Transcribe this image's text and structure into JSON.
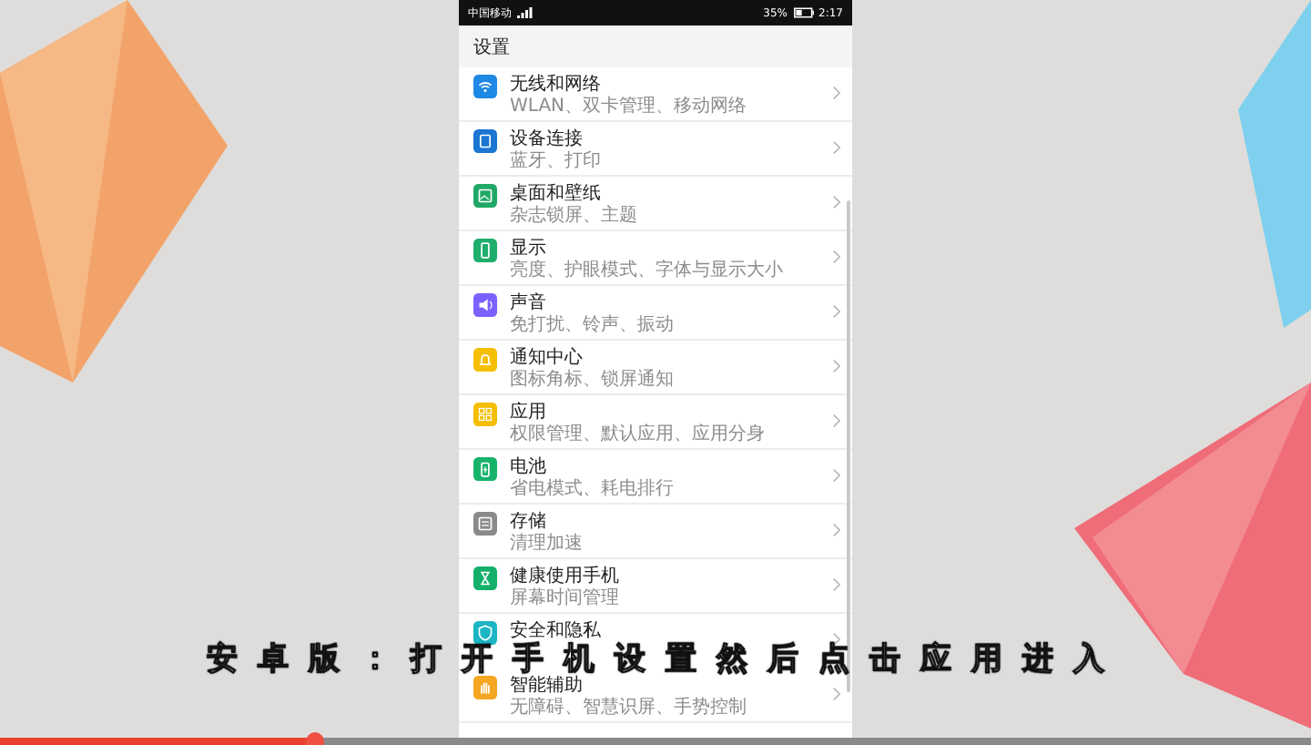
{
  "status_bar": {
    "carrier": "中国移动",
    "battery": "35%",
    "time": "2:17"
  },
  "header": {
    "title": "设置"
  },
  "items": [
    {
      "title": "无线和网络",
      "subtitle": "WLAN、双卡管理、移动网络"
    },
    {
      "title": "设备连接",
      "subtitle": "蓝牙、打印"
    },
    {
      "title": "桌面和壁纸",
      "subtitle": "杂志锁屏、主题"
    },
    {
      "title": "显示",
      "subtitle": "亮度、护眼模式、字体与显示大小"
    },
    {
      "title": "声音",
      "subtitle": "免打扰、铃声、振动"
    },
    {
      "title": "通知中心",
      "subtitle": "图标角标、锁屏通知"
    },
    {
      "title": "应用",
      "subtitle": "权限管理、默认应用、应用分身"
    },
    {
      "title": "电池",
      "subtitle": "省电模式、耗电排行"
    },
    {
      "title": "存储",
      "subtitle": "清理加速"
    },
    {
      "title": "健康使用手机",
      "subtitle": "屏幕时间管理"
    },
    {
      "title": "安全和隐私"
    },
    {
      "title": "智能辅助",
      "subtitle": "无障碍、智慧识屏、手势控制"
    }
  ],
  "caption": "安卓版：打开手机设置然后点击应用进入",
  "video_progress": {
    "level": 0.24
  }
}
